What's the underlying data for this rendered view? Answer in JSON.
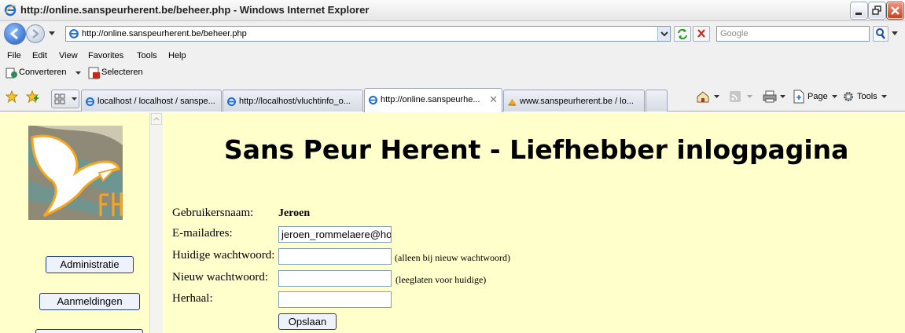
{
  "window": {
    "title": "http://online.sanspeurherent.be/beheer.php - Windows Internet Explorer"
  },
  "address_bar": {
    "url": "http://online.sanspeurherent.be/beheer.php",
    "search_placeholder": "Google"
  },
  "menu": [
    "File",
    "Edit",
    "View",
    "Favorites",
    "Tools",
    "Help"
  ],
  "extra_toolbar": {
    "convert_label": "Converteren",
    "select_label": "Selecteren"
  },
  "tabs": [
    {
      "label": "localhost / localhost / sanspe...",
      "active": false
    },
    {
      "label": "http://localhost/vluchtinfo_o...",
      "active": false
    },
    {
      "label": "http://online.sanspeurhe...",
      "active": true
    },
    {
      "label": "www.sanspeurherent.be / lo...",
      "active": false
    }
  ],
  "command_bar": {
    "page_label": "Page",
    "tools_label": "Tools"
  },
  "sidebar": {
    "buttons": [
      "Administratie",
      "Aanmeldingen"
    ]
  },
  "page": {
    "heading": "Sans Peur Herent - Liefhebber inlogpagina",
    "form": {
      "username_label": "Gebruikersnaam:",
      "username_value": "Jeroen",
      "email_label": "E-mailadres:",
      "email_value": "jeroen_rommelaere@hotmail.com",
      "current_pw_label": "Huidige wachtwoord:",
      "current_pw_hint": "(alleen bij nieuw wachtwoord)",
      "new_pw_label": "Nieuw wachtwoord:",
      "new_pw_hint": "(leeglaten voor huidige)",
      "repeat_label": "Herhaal:",
      "save_label": "Opslaan"
    }
  },
  "colors": {
    "page_background": "#ffffcc",
    "logo_accent": "#f5a623"
  }
}
